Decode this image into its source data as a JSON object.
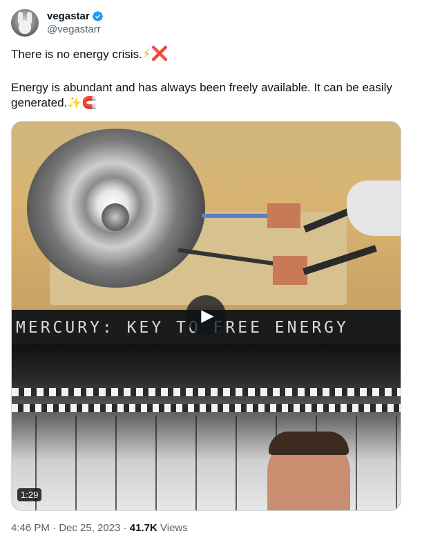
{
  "tweet": {
    "display_name": "vegastar",
    "handle": "@vegastarr",
    "text_line1": "There is no energy crisis.",
    "text_line1_emojis": [
      "⚡",
      "❌"
    ],
    "text_line2": "Energy is abundant and has always been freely available. It can be easily generated.",
    "text_line2_emojis": [
      "✨",
      "🧲"
    ],
    "time": "4:46 PM",
    "separator": "·",
    "date": "Dec 25, 2023",
    "views_count": "41.7K",
    "views_label": "Views"
  },
  "video": {
    "caption": "MERCURY: KEY TO FREE ENERGY",
    "duration": "1:29",
    "play_glyph": "▶"
  },
  "colors": {
    "verified_blue": "#1d9bf0",
    "secondary_text": "#536471",
    "primary_text": "#0f1419"
  },
  "icons": {
    "verified": "verified-badge-icon",
    "play": "play-icon"
  }
}
